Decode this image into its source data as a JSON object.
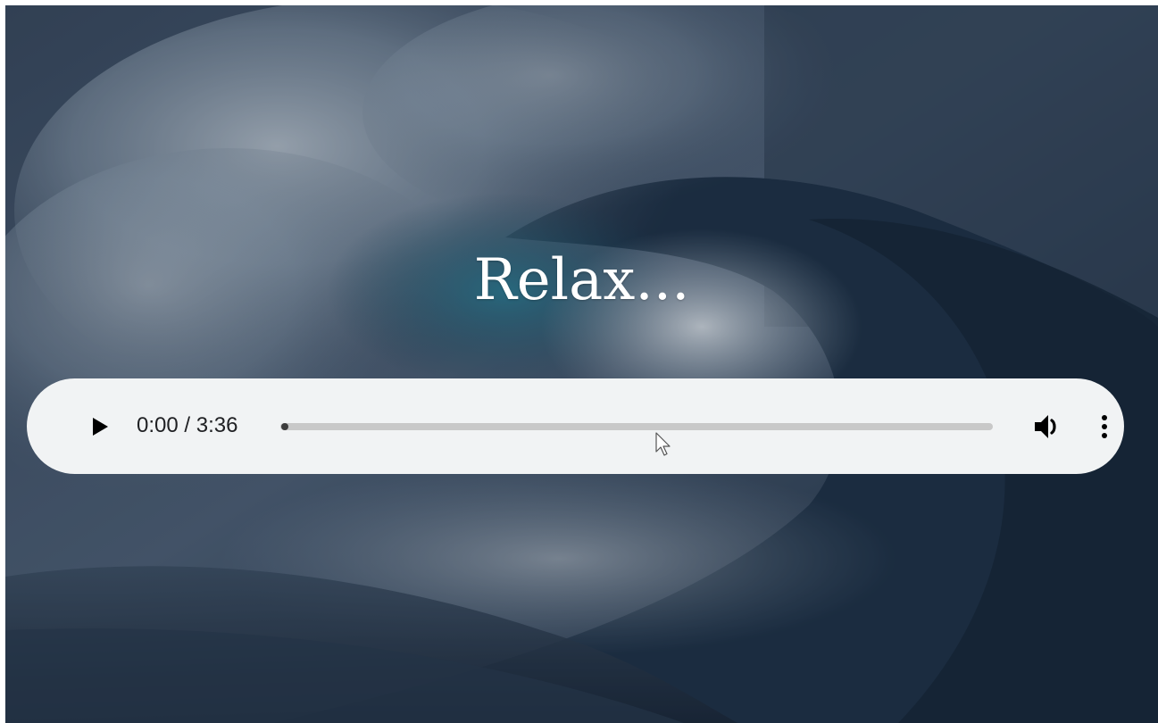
{
  "page": {
    "title": "Relax..."
  },
  "player": {
    "current_time": "0:00",
    "duration": "3:36",
    "time_display": "0:00 / 3:36",
    "progress_fraction": 0.0,
    "icons": {
      "play": "play-icon",
      "volume": "volume-icon",
      "more": "more-options-icon"
    }
  },
  "colors": {
    "player_bg": "#f1f3f4",
    "title_text": "#ffffff",
    "track": "#c8c8c8",
    "icon": "#000000"
  }
}
